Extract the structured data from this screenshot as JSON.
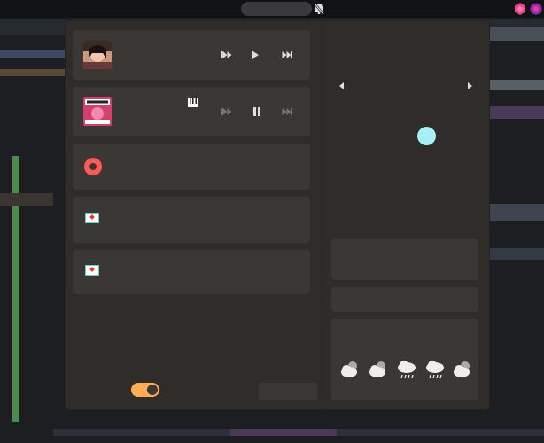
{
  "colors": {
    "accent": "#ffac56",
    "record": "#ff5a5a",
    "cursor_dot": "#a8f0f5",
    "panel": "#2f2c2a",
    "card": "#3b3734"
  },
  "media": [
    {
      "thumb": "album-art-1",
      "controls": [
        "previous-icon",
        "play-icon",
        "next-icon"
      ],
      "dim": false
    },
    {
      "thumb": "album-art-2",
      "badge": "piano-icon",
      "controls": [
        "previous-icon",
        "pause-icon",
        "next-icon"
      ],
      "dim": true
    }
  ],
  "toggle": {
    "on": true
  },
  "weather": [
    "cloud-sun-icon",
    "cloud-sun-icon",
    "cloud-rain-icon",
    "cloud-rain-icon",
    "cloud-sun-icon"
  ]
}
